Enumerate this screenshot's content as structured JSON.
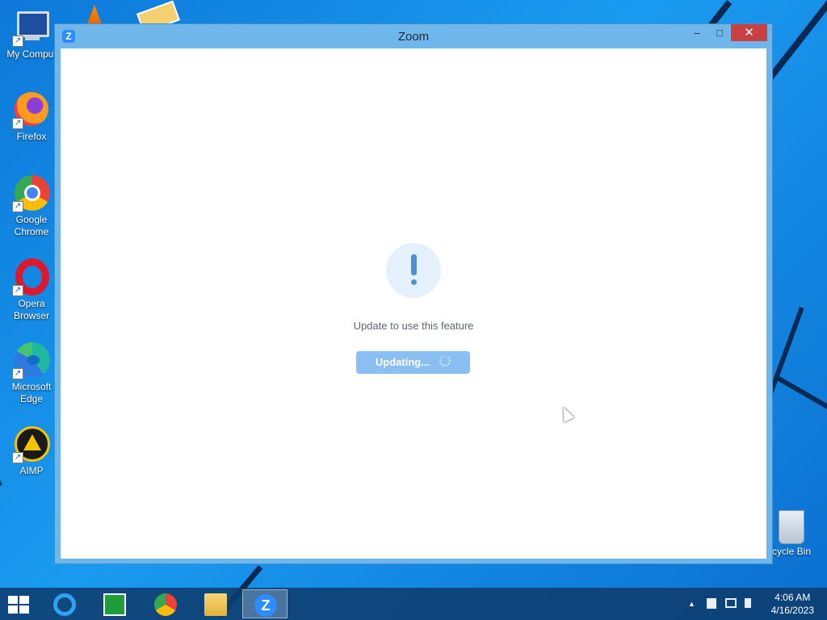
{
  "desktop": {
    "icons": [
      {
        "label": "My Comput",
        "icon": "my-computer-icon"
      },
      {
        "label": "Firefox",
        "icon": "firefox-icon"
      },
      {
        "label": "Google Chrome",
        "icon": "chrome-icon"
      },
      {
        "label": "Opera Browser",
        "icon": "opera-icon"
      },
      {
        "label": "Microsoft Edge",
        "icon": "edge-icon"
      },
      {
        "label": "AIMP",
        "icon": "aimp-icon"
      }
    ],
    "recycle_bin": {
      "label": "cycle Bin",
      "icon": "recycle-bin-icon"
    }
  },
  "window": {
    "title": "Zoom",
    "app_icon": "Z",
    "controls": {
      "minimize": "–",
      "maximize": "□",
      "close": "✕"
    },
    "message": "Update to use this feature",
    "button_label": "Updating..."
  },
  "taskbar": {
    "items": [
      "start-button",
      "internet-explorer-icon",
      "store-icon",
      "chrome-icon",
      "file-explorer-icon",
      "zoom-icon"
    ],
    "active_item": "zoom-icon",
    "tray": {
      "up_arrow": "▲"
    },
    "clock": {
      "time": "4:06 AM",
      "date": "4/16/2023"
    }
  },
  "colors": {
    "accent": "#2d8cff",
    "button_disabled": "#89bff2",
    "close_button": "#c94040",
    "window_frame": "#6fb7ea"
  }
}
